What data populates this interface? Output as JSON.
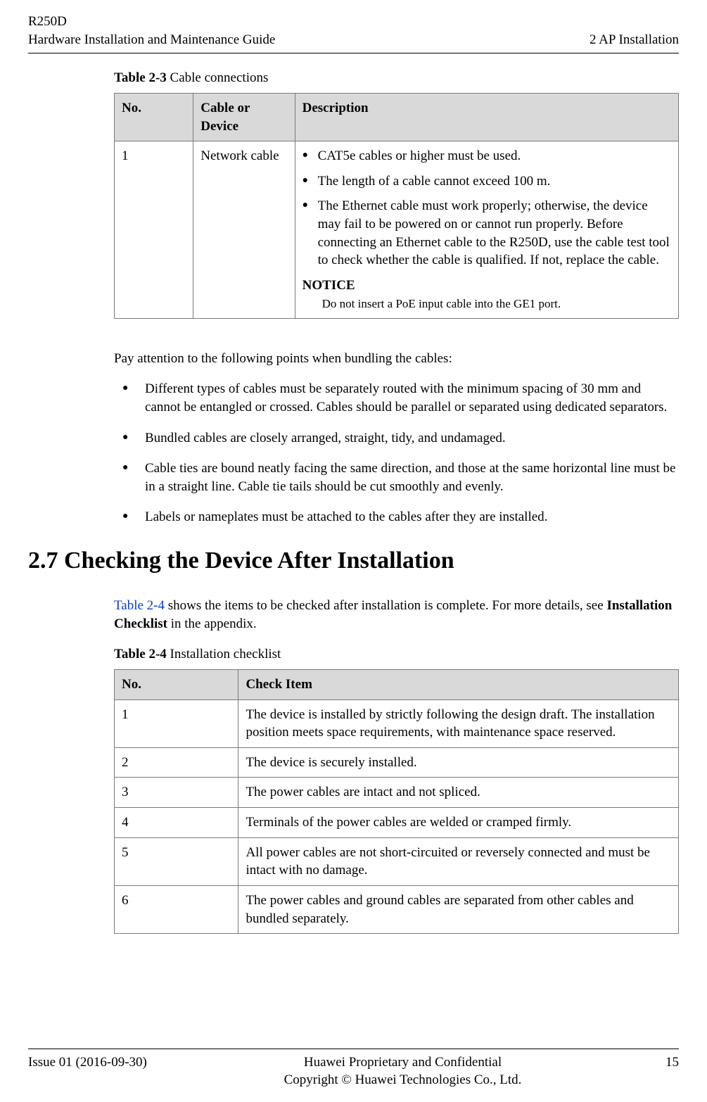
{
  "header": {
    "product": "R250D",
    "guide": "Hardware Installation and Maintenance Guide",
    "chapter": "2 AP Installation"
  },
  "table1": {
    "caption_prefix": "Table 2-3",
    "caption_text": " Cable connections",
    "head": {
      "no": "No.",
      "cable": "Cable or Device",
      "desc": "Description"
    },
    "row": {
      "no": "1",
      "cable": "Network cable",
      "b1": "CAT5e cables or higher must be used.",
      "b2": "The length of a cable cannot exceed 100 m.",
      "b3": "The Ethernet cable must work properly; otherwise, the device may fail to be powered on or cannot run properly. Before connecting an Ethernet cable to the R250D, use the cable test tool to check whether the cable is qualified. If not, replace the cable.",
      "notice_label": "NOTICE",
      "notice_text": "Do not insert a PoE input cable into the GE1 port."
    }
  },
  "para": "Pay attention to the following points when bundling the cables:",
  "bullets": {
    "b1": "Different types of cables must be separately routed with the minimum spacing of 30 mm and cannot be entangled or crossed. Cables should be parallel or separated using dedicated separators.",
    "b2": "Bundled cables are closely arranged, straight, tidy, and undamaged.",
    "b3": "Cable ties are bound neatly facing the same direction, and those at the same horizontal line must be in a straight line. Cable tie tails should be cut smoothly and evenly.",
    "b4": "Labels or nameplates must be attached to the cables after they are installed."
  },
  "section_heading": "2.7 Checking the Device After Installation",
  "para2": {
    "link": "Table 2-4",
    "mid": " shows the items to be checked after installation is complete. For more details, see ",
    "bold": "Installation Checklist",
    "tail": " in the appendix."
  },
  "table2": {
    "caption_prefix": "Table 2-4",
    "caption_text": " Installation checklist",
    "head": {
      "no": "No.",
      "item": "Check Item"
    },
    "rows": {
      "r1n": "1",
      "r1i": "The device is installed by strictly following the design draft. The installation position meets space requirements, with maintenance space reserved.",
      "r2n": "2",
      "r2i": "The device is securely installed.",
      "r3n": "3",
      "r3i": "The power cables are intact and not spliced.",
      "r4n": "4",
      "r4i": "Terminals of the power cables are welded or cramped firmly.",
      "r5n": "5",
      "r5i": "All power cables are not short-circuited or reversely connected and must be intact with no damage.",
      "r6n": "6",
      "r6i": "The power cables and ground cables are separated from other cables and bundled separately."
    }
  },
  "footer": {
    "issue": "Issue 01 (2016-09-30)",
    "line1": "Huawei Proprietary and Confidential",
    "line2": "Copyright © Huawei Technologies Co., Ltd.",
    "page": "15"
  }
}
